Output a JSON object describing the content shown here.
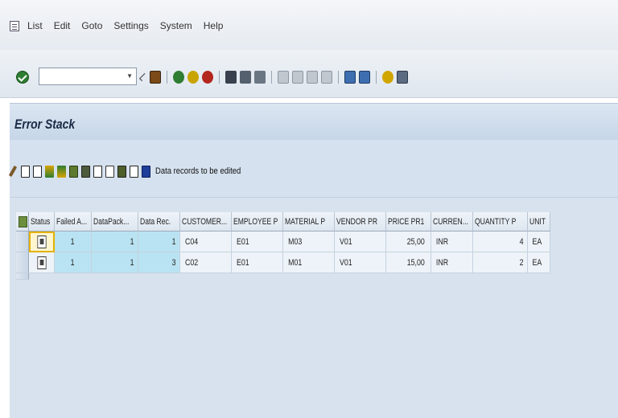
{
  "menu": {
    "items": [
      "List",
      "Edit",
      "Goto",
      "Settings",
      "System",
      "Help"
    ]
  },
  "toolbar": {
    "command_field_value": "",
    "icons": [
      "back-icon",
      "save-icon",
      "exit-icon",
      "cancel-icon",
      "print-icon",
      "find-icon",
      "find-next-icon",
      "first-page-icon",
      "previous-page-icon",
      "next-page-icon",
      "last-page-icon",
      "create-session-icon",
      "shortcut-icon",
      "help-icon",
      "layout-icon"
    ]
  },
  "page": {
    "title": "Error Stack"
  },
  "app_toolbar": {
    "icons": [
      "edit-icon",
      "delete-icon",
      "details-icon",
      "sort-ascending-icon",
      "sort-descending-icon",
      "filter-icon",
      "export-icon",
      "print-preview-icon",
      "set-filter-icon",
      "total-icon",
      "subtotal-icon",
      "info-icon"
    ],
    "data_records_label": "Data records to be edited"
  },
  "table": {
    "columns": [
      "Status",
      "Failed A...",
      "DataPack...",
      "Data Rec.",
      "CUSTOMER...",
      "EMPLOYEE P",
      "MATERIAL P",
      "VENDOR PR",
      "PRICE PR1",
      "CURREN...",
      "QUANTITY P",
      "UNIT"
    ],
    "rows": [
      {
        "status": "error-log-icon",
        "failed": "1",
        "datapack": "1",
        "datarec": "1",
        "customer": "C04",
        "employee": "E01",
        "material": "M03",
        "vendor": "V01",
        "price": "25,00",
        "currency": "INR",
        "quantity": "4",
        "unit": "EA"
      },
      {
        "status": "error-log-icon",
        "failed": "1",
        "datapack": "1",
        "datarec": "3",
        "customer": "C02",
        "employee": "E01",
        "material": "M01",
        "vendor": "V01",
        "price": "15,00",
        "currency": "INR",
        "quantity": "2",
        "unit": "EA"
      }
    ]
  }
}
